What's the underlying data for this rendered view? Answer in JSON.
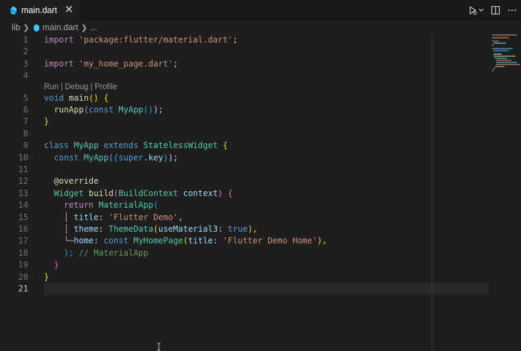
{
  "tab": {
    "filename": "main.dart",
    "close_glyph": "✕"
  },
  "breadcrumb": {
    "folder": "lib",
    "file": "main.dart",
    "more": "..."
  },
  "codelens": {
    "run": "Run",
    "sep1": " | ",
    "debug": "Debug",
    "sep2": " | ",
    "profile": "Profile"
  },
  "line_numbers": [
    "1",
    "2",
    "3",
    "4",
    "5",
    "6",
    "7",
    "8",
    "9",
    "10",
    "11",
    "12",
    "13",
    "14",
    "15",
    "16",
    "17",
    "18",
    "19",
    "20",
    "21"
  ],
  "active_line": "21",
  "code": {
    "l1": {
      "kw": "import",
      "str": "'package:flutter/material.dart'",
      "end": ";"
    },
    "l3": {
      "kw": "import",
      "str": "'my_home_page.dart'",
      "end": ";"
    },
    "l5": {
      "kw": "void",
      "fn": "main",
      "p1": "()",
      "rest": " {"
    },
    "l6": {
      "fn": "runApp",
      "op": "(",
      "kw": "const",
      "cls": "MyApp",
      "call": "()",
      "end": ");"
    },
    "l7": "}",
    "l9": {
      "kw1": "class",
      "cls1": "MyApp",
      "kw2": "extends",
      "cls2": "StatelessWidget",
      "br": "{"
    },
    "l10": {
      "kw": "const",
      "cls": "MyApp",
      "op": "(",
      "br": "{",
      "sup": "super",
      "dot": ".",
      "key": "key",
      "brc": "}",
      "end": ");"
    },
    "l12": "@override",
    "l13": {
      "cls1": "Widget",
      "fn": "build",
      "op": "(",
      "cls2": "BuildContext",
      "var": "context",
      "cl": ")",
      "br": "{"
    },
    "l14": {
      "kw": "return",
      "cls": "MaterialApp",
      "op": "("
    },
    "l15": {
      "tree": "│",
      "var": "title",
      "colon": ":",
      "str": "'Flutter Demo'",
      "end": ","
    },
    "l16": {
      "tree": "│",
      "var": "theme",
      "colon": ":",
      "cls": "ThemeData",
      "op": "(",
      "arg": "useMaterial3",
      "colon2": ":",
      "kw": "true",
      "end": "),"
    },
    "l17": {
      "tree": "└─",
      "var": "home",
      "colon": ":",
      "kw": "const",
      "cls": "MyHomePage",
      "op": "(",
      "arg": "title",
      "colon2": ":",
      "str": "'Flutter Demo Home'",
      "end": "),"
    },
    "l18": {
      "end": ");",
      "com": "// MaterialApp"
    },
    "l19": "}",
    "l20": "}"
  },
  "icons": {
    "tab": "dart-icon",
    "run": "run-debug-icon",
    "split": "split-editor-icon",
    "more": "more-actions-icon"
  },
  "colors": {
    "accent": "#569cd6",
    "string": "#ce9178",
    "class": "#4ec9b0"
  }
}
